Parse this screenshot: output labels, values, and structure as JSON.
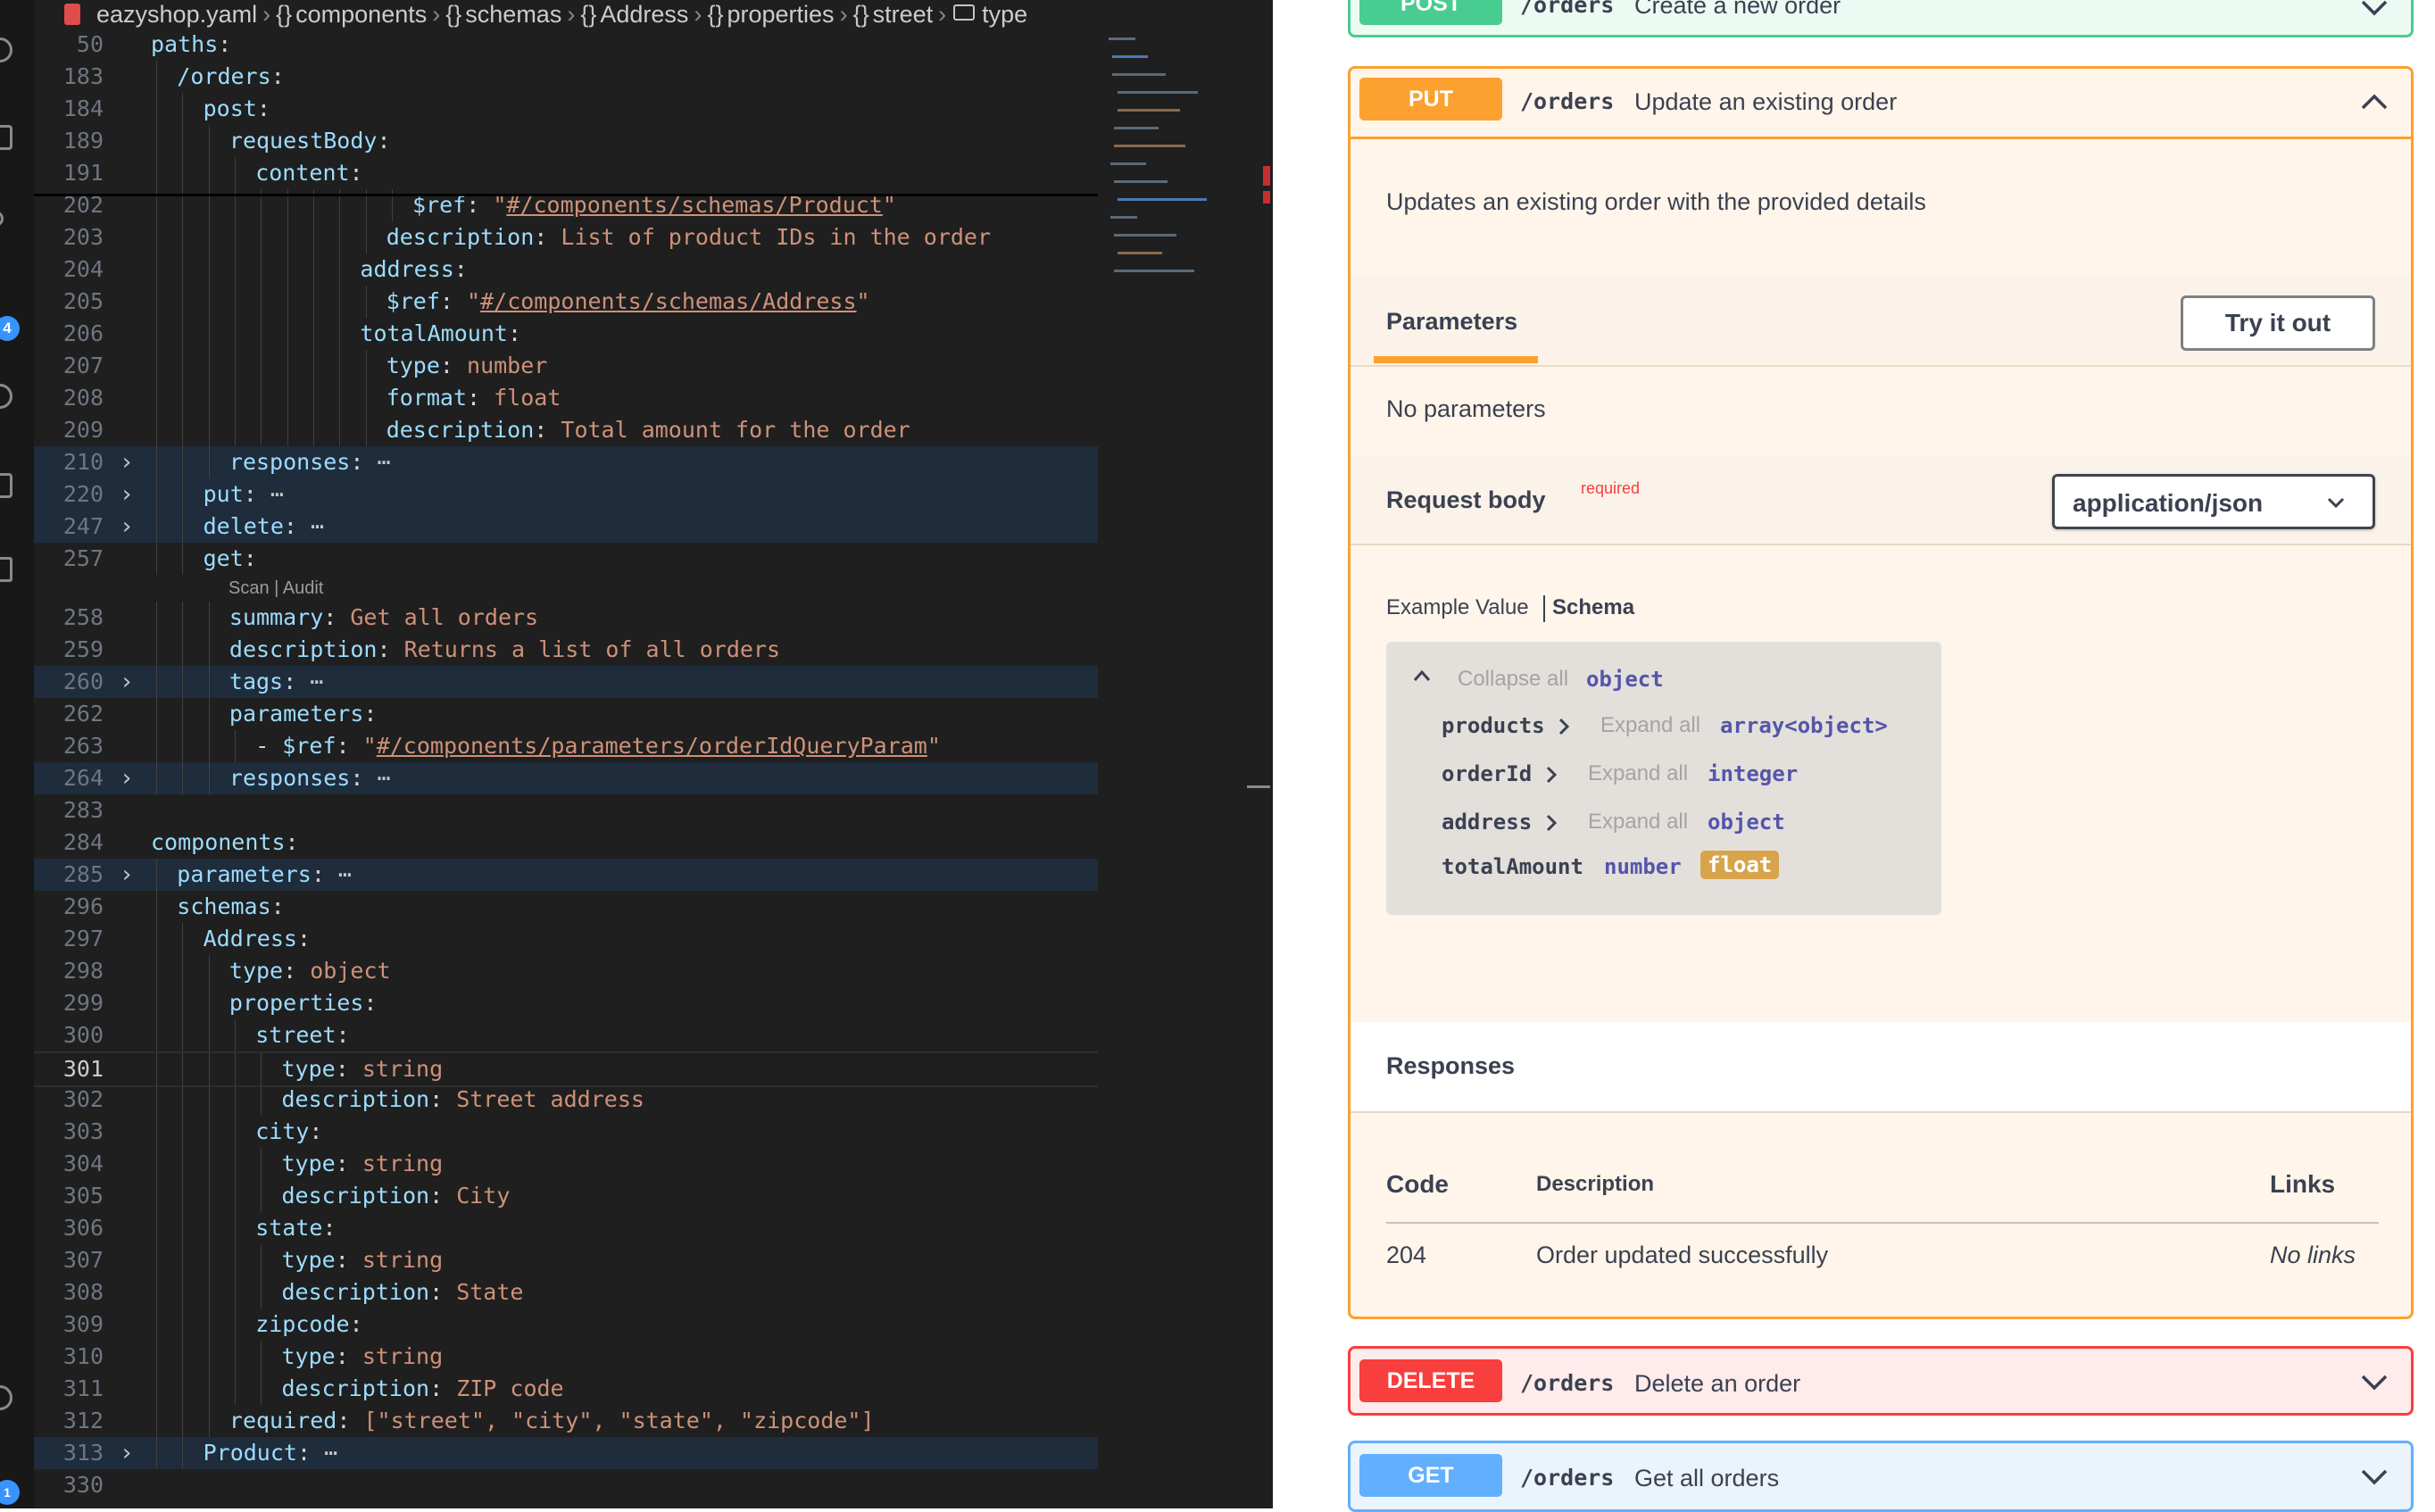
{
  "editor": {
    "breadcrumb": [
      "eazyshop.yaml",
      "components",
      "schemas",
      "Address",
      "properties",
      "street",
      "type"
    ],
    "codelens": "Scan | Audit",
    "lines": [
      {
        "n": "50",
        "indent": 0,
        "key": "paths",
        "rest": ""
      },
      {
        "n": "183",
        "indent": 1,
        "key": "/orders",
        "rest": ""
      },
      {
        "n": "184",
        "indent": 2,
        "key": "post",
        "rest": ""
      },
      {
        "n": "189",
        "indent": 3,
        "key": "requestBody",
        "rest": ""
      },
      {
        "n": "191",
        "indent": 4,
        "key": "content",
        "rest": ""
      },
      {
        "n": "202",
        "indent": 10,
        "key": "$ref",
        "ref": "#/components/schemas/Product"
      },
      {
        "n": "203",
        "indent": 9,
        "key": "description",
        "val": "List of product IDs in the order"
      },
      {
        "n": "204",
        "indent": 8,
        "key": "address",
        "rest": ""
      },
      {
        "n": "205",
        "indent": 9,
        "key": "$ref",
        "ref": "#/components/schemas/Address"
      },
      {
        "n": "206",
        "indent": 8,
        "key": "totalAmount",
        "rest": ""
      },
      {
        "n": "207",
        "indent": 9,
        "key": "type",
        "val": "number"
      },
      {
        "n": "208",
        "indent": 9,
        "key": "format",
        "val": "float"
      },
      {
        "n": "209",
        "indent": 9,
        "key": "description",
        "val": "Total amount for the order"
      },
      {
        "n": "210",
        "indent": 3,
        "key": "responses",
        "folded": true
      },
      {
        "n": "220",
        "indent": 2,
        "key": "put",
        "folded": true
      },
      {
        "n": "247",
        "indent": 2,
        "key": "delete",
        "folded": true
      },
      {
        "n": "257",
        "indent": 2,
        "key": "get",
        "rest": ""
      },
      {
        "n": "258",
        "indent": 3,
        "key": "summary",
        "val": "Get all orders"
      },
      {
        "n": "259",
        "indent": 3,
        "key": "description",
        "val": "Returns a list of all orders"
      },
      {
        "n": "260",
        "indent": 3,
        "key": "tags",
        "folded": true
      },
      {
        "n": "262",
        "indent": 3,
        "key": "parameters",
        "rest": ""
      },
      {
        "n": "263",
        "indent": 4,
        "dash": true,
        "key": "$ref",
        "ref": "#/components/parameters/orderIdQueryParam"
      },
      {
        "n": "264",
        "indent": 3,
        "key": "responses",
        "folded": true
      },
      {
        "n": "283",
        "indent": 0,
        "blank": true
      },
      {
        "n": "284",
        "indent": 0,
        "key": "components",
        "rest": ""
      },
      {
        "n": "285",
        "indent": 1,
        "key": "parameters",
        "folded": true
      },
      {
        "n": "296",
        "indent": 1,
        "key": "schemas",
        "rest": ""
      },
      {
        "n": "297",
        "indent": 2,
        "key": "Address",
        "rest": ""
      },
      {
        "n": "298",
        "indent": 3,
        "key": "type",
        "val": "object"
      },
      {
        "n": "299",
        "indent": 3,
        "key": "properties",
        "rest": ""
      },
      {
        "n": "300",
        "indent": 4,
        "key": "street",
        "rest": ""
      },
      {
        "n": "301",
        "indent": 5,
        "key": "type",
        "val": "string",
        "active": true
      },
      {
        "n": "302",
        "indent": 5,
        "key": "description",
        "val": "Street address"
      },
      {
        "n": "303",
        "indent": 4,
        "key": "city",
        "rest": ""
      },
      {
        "n": "304",
        "indent": 5,
        "key": "type",
        "val": "string"
      },
      {
        "n": "305",
        "indent": 5,
        "key": "description",
        "val": "City"
      },
      {
        "n": "306",
        "indent": 4,
        "key": "state",
        "rest": ""
      },
      {
        "n": "307",
        "indent": 5,
        "key": "type",
        "val": "string"
      },
      {
        "n": "308",
        "indent": 5,
        "key": "description",
        "val": "State"
      },
      {
        "n": "309",
        "indent": 4,
        "key": "zipcode",
        "rest": ""
      },
      {
        "n": "310",
        "indent": 5,
        "key": "type",
        "val": "string"
      },
      {
        "n": "311",
        "indent": 5,
        "key": "description",
        "val": "ZIP code"
      },
      {
        "n": "312",
        "indent": 3,
        "key": "required",
        "list": [
          "street",
          "city",
          "state",
          "zipcode"
        ]
      },
      {
        "n": "313",
        "indent": 2,
        "key": "Product",
        "folded": true
      },
      {
        "n": "330",
        "indent": 0,
        "blank": true
      }
    ]
  },
  "swagger": {
    "post": {
      "method": "POST",
      "path": "/orders",
      "summary": "Create a new order"
    },
    "put": {
      "method": "PUT",
      "path": "/orders",
      "summary": "Update an existing order",
      "description": "Updates an existing order with the provided details",
      "parameters_tab": "Parameters",
      "try_button": "Try it out",
      "no_params": "No parameters",
      "request_body_label": "Request body",
      "required_label": "required",
      "content_type": "application/json",
      "example_tab": "Example Value",
      "schema_tab": "Schema",
      "schema": {
        "collapse_all": "Collapse all",
        "root_type": "object",
        "props": [
          {
            "name": "products",
            "expand": "Expand all",
            "type": "array<object>"
          },
          {
            "name": "orderId",
            "expand": "Expand all",
            "type": "integer"
          },
          {
            "name": "address",
            "expand": "Expand all",
            "type": "object"
          },
          {
            "name": "totalAmount",
            "type": "number",
            "format": "float"
          }
        ]
      },
      "responses_title": "Responses",
      "resp_headers": {
        "code": "Code",
        "description": "Description",
        "links": "Links"
      },
      "responses": [
        {
          "code": "204",
          "description": "Order updated successfully",
          "links": "No links"
        }
      ]
    },
    "delete": {
      "method": "DELETE",
      "path": "/orders",
      "summary": "Delete an order"
    },
    "get": {
      "method": "GET",
      "path": "/orders",
      "summary": "Get all orders"
    }
  },
  "colors": {
    "post": "#49cc90",
    "put": "#fca130",
    "delete": "#f93e3e",
    "get": "#61affe",
    "editor_bg": "#1f1f1f",
    "fold_highlight": "#1f2c3c"
  }
}
